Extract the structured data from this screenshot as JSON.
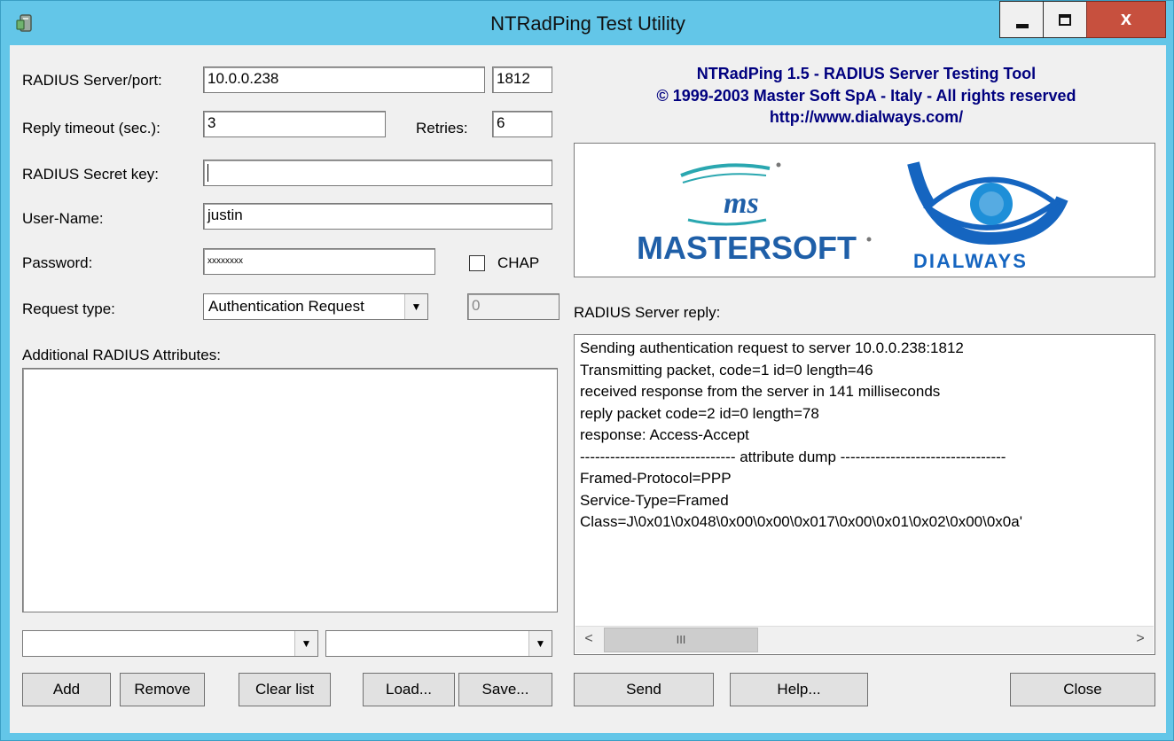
{
  "window": {
    "title": "NTRadPing Test Utility",
    "minimize_glyph": "_",
    "maximize_glyph": "□",
    "close_glyph": "x"
  },
  "form": {
    "server_label": "RADIUS Server/port:",
    "server_value": "10.0.0.238",
    "port_value": "1812",
    "timeout_label": "Reply timeout (sec.):",
    "timeout_value": "3",
    "retries_label": "Retries:",
    "retries_value": "6",
    "secret_label": "RADIUS Secret key:",
    "secret_value": "",
    "username_label": "User-Name:",
    "username_value": "justin",
    "password_label": "Password:",
    "password_value": "xxxxxxxx",
    "chap_label": "CHAP",
    "chap_checked": false,
    "request_type_label": "Request type:",
    "request_type_value": "Authentication Request",
    "request_id_value": "0",
    "attributes_label": "Additional RADIUS Attributes:",
    "attr_combo1_value": "",
    "attr_combo2_value": ""
  },
  "buttons": {
    "add": "Add",
    "remove": "Remove",
    "clear_list": "Clear list",
    "load": "Load...",
    "save": "Save...",
    "send": "Send",
    "help": "Help...",
    "close": "Close"
  },
  "header": {
    "line1": "NTRadPing 1.5 - RADIUS Server Testing Tool",
    "line2": "© 1999-2003 Master Soft SpA - Italy - All rights reserved",
    "line3": "http://www.dialways.com/"
  },
  "logos": {
    "mastersoft_text": "MASTERSOFT",
    "ms_text": "ms",
    "dialways_text": "DIALWAYS",
    "colors": {
      "brand_blue": "#1f5fa8",
      "teal": "#2aa7b0",
      "dialways_blue": "#1565c0"
    }
  },
  "reply": {
    "label": "RADIUS Server reply:",
    "lines": [
      "Sending authentication request to server 10.0.0.238:1812",
      "Transmitting packet, code=1 id=0 length=46",
      "received response from the server in 141 milliseconds",
      "reply packet code=2 id=0 length=78",
      "response: Access-Accept",
      "------------------------------- attribute dump ---------------------------------",
      "Framed-Protocol=PPP",
      "Service-Type=Framed",
      "Class=J\\0x01\\0x048\\0x00\\0x00\\0x017\\0x00\\0x01\\0x02\\0x00\\0x0a'"
    ],
    "scroll_thumb_glyph": "III"
  }
}
